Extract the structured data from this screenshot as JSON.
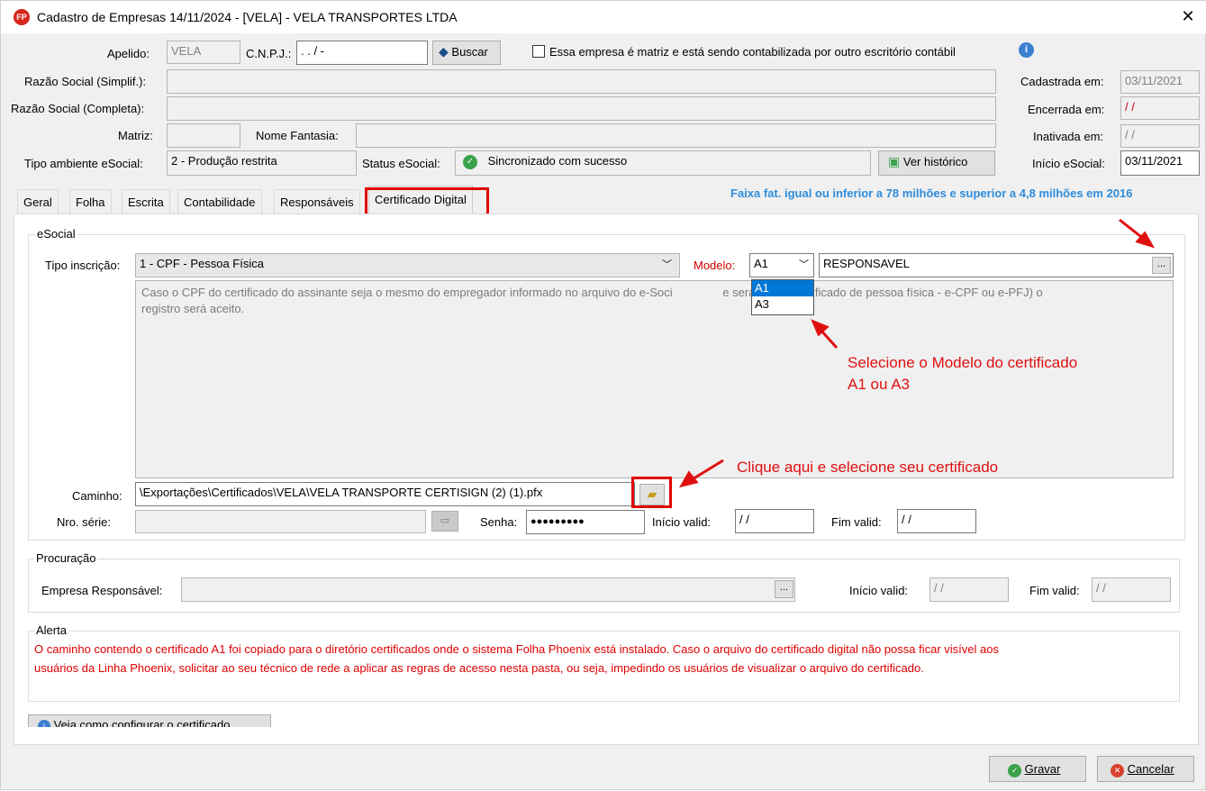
{
  "window": {
    "title": "Cadastro de Empresas  14/11/2024 - [VELA] - VELA TRANSPORTES LTDA",
    "app_icon": "FP",
    "close_glyph": "✕"
  },
  "header": {
    "apelido_label": "Apelido:",
    "apelido_value": "VELA",
    "cnpj_label": "C.N.P.J.:",
    "cnpj_value": " .  .  /   -",
    "buscar_label": "Buscar",
    "matriz_checkbox_label": "Essa empresa é matriz e está sendo contabilizada por outro escritório contábil",
    "razao_simplif_label": "Razão Social (Simplif.):",
    "razao_completa_label": "Razão Social (Completa):",
    "matriz_label": "Matriz:",
    "nome_fantasia_label": "Nome Fantasia:",
    "tipo_ambiente_label": "Tipo ambiente eSocial:",
    "tipo_ambiente_value": "2 - Produção restrita",
    "status_esocial_label": "Status eSocial:",
    "status_esocial_value": "Sincronizado com sucesso",
    "ver_historico_label": "Ver histórico",
    "cadastrada_label": "Cadastrada em:",
    "cadastrada_value": "03/11/2021",
    "encerrada_label": "Encerrada em:",
    "encerrada_value": " /  /",
    "inativada_label": "Inativada em:",
    "inativada_value": " /  /",
    "inicio_esocial_label": "Início eSocial:",
    "inicio_esocial_value": "03/11/2021"
  },
  "faixa_info": "Faixa fat. igual ou inferior a 78 milhões e superior a 4,8 milhões em 2016",
  "tabs": [
    "Geral",
    "Folha",
    "Escrita",
    "Contabilidade",
    "Responsáveis",
    "Certificado Digital"
  ],
  "esocial": {
    "group_title": "eSocial",
    "tipo_inscricao_label": "Tipo inscrição:",
    "tipo_inscricao_value": "1 - CPF - Pessoa Física",
    "modelo_label": "Modelo:",
    "modelo_value": "A1",
    "modelo_options": [
      "A1",
      "A3"
    ],
    "responsavel_value": "RESPONSAVEL",
    "ellipsis": "...",
    "memo_line1_a": "Caso o CPF do certificado do assinante seja o mesmo do empregador informado no arquivo do e-Soci",
    "memo_line1_b": "e será aceito certificado de pessoa física - e-CPF ou e-PFJ) o",
    "memo_line2": "registro será aceito.",
    "caminho_label": "Caminho:",
    "caminho_value": "\\Exportações\\Certificados\\VELA\\VELA TRANSPORTE CERTISIGN (2) (1).pfx",
    "nro_serie_label": "Nro. série:",
    "senha_label": "Senha:",
    "senha_value": "●●●●●●●●●",
    "inicio_valid_label": "Início valid:",
    "inicio_valid_value": " /  /",
    "fim_valid_label": "Fim valid:",
    "fim_valid_value": " /  /"
  },
  "procuracao": {
    "group_title": "Procuração",
    "empresa_label": "Empresa Responsável:",
    "ellipsis": "...",
    "inicio_valid_label": "Início valid:",
    "inicio_valid_value": " /  /",
    "fim_valid_label": "Fim valid:",
    "fim_valid_value": " /  /"
  },
  "alerta": {
    "group_title": "Alerta",
    "line1": "O caminho contendo o certificado A1 foi copiado para o diretório certificados onde o sistema Folha Phoenix está instalado. Caso o arquivo do certificado digital não possa ficar visível aos",
    "line2": "usuários da Linha Phoenix, solicitar ao seu técnico de rede a aplicar as regras de acesso nesta pasta, ou seja, impedindo os usuários de visualizar o arquivo do certificado."
  },
  "veja_label": "Veja como configurar o certificado",
  "footer": {
    "gravar_label": "Gravar",
    "cancelar_label": "Cancelar"
  },
  "annotations": {
    "modelo_line1": "Selecione o Modelo do certificado",
    "modelo_line2": "A1 ou A3",
    "caminho": "Clique aqui e selecione seu certificado"
  },
  "colors": {
    "annotation_red": "#e01010",
    "info_blue": "#2e8ddb",
    "selection_blue": "#0078d7"
  }
}
